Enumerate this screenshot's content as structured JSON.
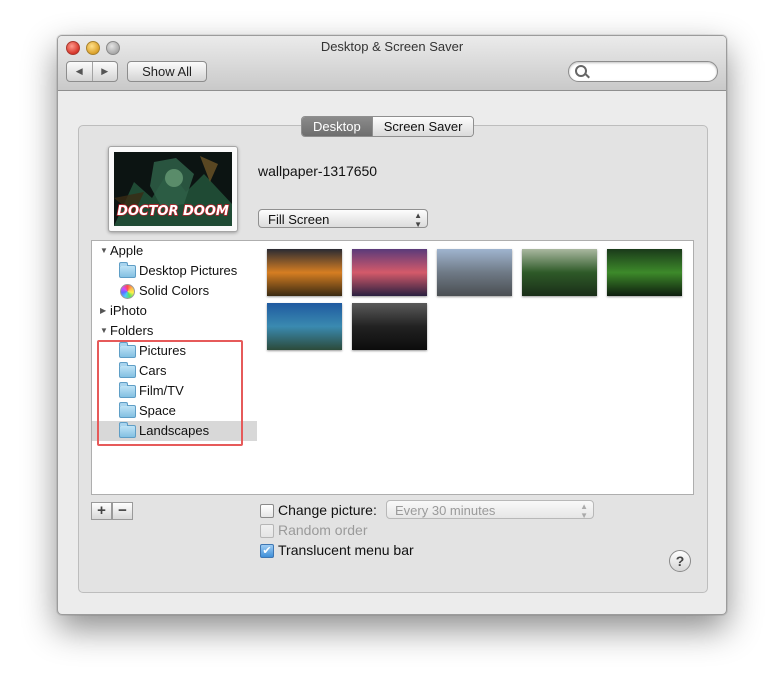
{
  "window": {
    "title": "Desktop & Screen Saver"
  },
  "toolbar": {
    "back_label": "◀",
    "forward_label": "▶",
    "show_all_label": "Show All",
    "search_placeholder": ""
  },
  "tabs": [
    {
      "label": "Desktop",
      "active": true
    },
    {
      "label": "Screen Saver",
      "active": false
    }
  ],
  "current_wallpaper": {
    "name": "wallpaper-1317650",
    "preview_text": "DOCTOR DOOM"
  },
  "fill_mode": {
    "value": "Fill Screen"
  },
  "sidebar": {
    "groups": [
      {
        "label": "Apple",
        "expanded": true,
        "items": [
          "Desktop Pictures",
          "Solid Colors"
        ]
      },
      {
        "label": "iPhoto",
        "expanded": false,
        "items": []
      },
      {
        "label": "Folders",
        "expanded": true,
        "items": [
          "Pictures",
          "Cars",
          "Film/TV",
          "Space",
          "Landscapes"
        ],
        "selected": "Landscapes"
      }
    ]
  },
  "thumbnails": [
    {
      "name": "sunset-clouds",
      "colors": [
        "#2a2b33",
        "#d67e22",
        "#3a2a12"
      ]
    },
    {
      "name": "purple-sky-lake",
      "colors": [
        "#5a3a7a",
        "#d45a6a",
        "#2a2040"
      ]
    },
    {
      "name": "mountain-village",
      "colors": [
        "#9fb4cf",
        "#6f7a86",
        "#4a4e52"
      ]
    },
    {
      "name": "pagoda-lake",
      "colors": [
        "#aab8a0",
        "#2e5a28",
        "#1a2e18"
      ]
    },
    {
      "name": "jungle-waterfall",
      "colors": [
        "#1a3a1a",
        "#3d8a2a",
        "#0e1e0e"
      ]
    },
    {
      "name": "tropical-bay",
      "colors": [
        "#1f5aa0",
        "#3a8ab0",
        "#2c4a3a"
      ]
    },
    {
      "name": "night-beach",
      "colors": [
        "#5a5a5a",
        "#222222",
        "#0c0c0c"
      ]
    }
  ],
  "options": {
    "add_label": "+",
    "remove_label": "−",
    "change_picture": {
      "label": "Change picture:",
      "checked": false,
      "interval": "Every 30 minutes"
    },
    "random_order": {
      "label": "Random order",
      "checked": false,
      "enabled": false
    },
    "translucent_menu_bar": {
      "label": "Translucent menu bar",
      "checked": true
    },
    "help_label": "?"
  }
}
